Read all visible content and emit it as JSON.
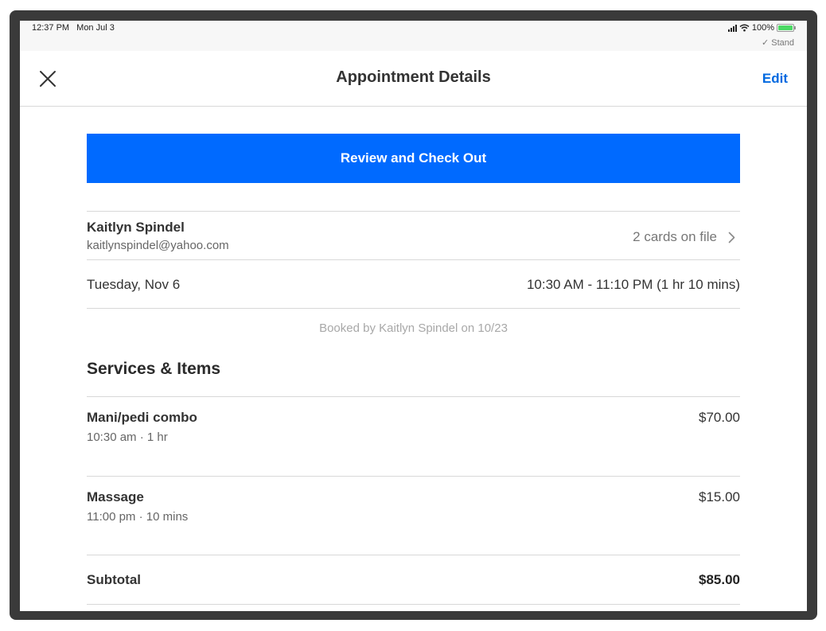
{
  "status_bar": {
    "time": "12:37 PM",
    "date": "Mon Jul 3",
    "battery": "100%",
    "stand": "Stand"
  },
  "nav": {
    "title": "Appointment Details",
    "edit_label": "Edit",
    "close_icon": "close-icon"
  },
  "primary_action": {
    "label": "Review and Check Out"
  },
  "customer": {
    "name": "Kaitlyn Spindel",
    "email": "kaitlynspindel@yahoo.com",
    "cards_label": "2 cards on file"
  },
  "schedule": {
    "date": "Tuesday, Nov 6",
    "time_range": "10:30 AM - 11:10 PM (1 hr 10 mins)"
  },
  "booked_by": "Booked by Kaitlyn Spindel on 10/23",
  "services_section": {
    "title": "Services & Items",
    "items": [
      {
        "name": "Mani/pedi combo",
        "meta": "10:30 am · 1 hr",
        "price": "$70.00"
      },
      {
        "name": "Massage",
        "meta": "11:00 pm · 10 mins",
        "price": "$15.00"
      }
    ]
  },
  "subtotal": {
    "label": "Subtotal",
    "value": "$85.00"
  },
  "colors": {
    "accent": "#006aff",
    "link": "#0069e0"
  }
}
